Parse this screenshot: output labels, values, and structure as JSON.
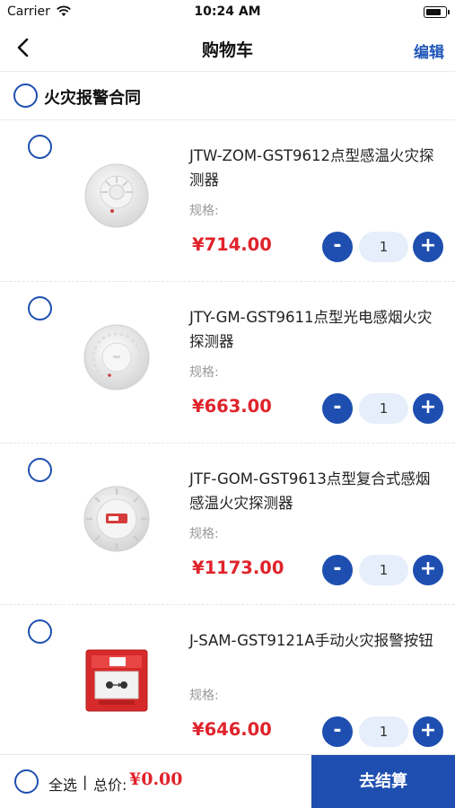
{
  "status_bar": {
    "carrier": "Carrier",
    "time": "10:24 AM"
  },
  "nav": {
    "title": "购物车",
    "edit_label": "编辑"
  },
  "group": {
    "title": "火灾报警合同"
  },
  "items": [
    {
      "name": "JTW-ZOM-GST9612点型感温火灾探测器",
      "spec_label": "规格:",
      "price": "¥714.00",
      "qty": "1",
      "minus": "-",
      "plus": "+",
      "image": "heat-detector"
    },
    {
      "name": "JTY-GM-GST9611点型光电感烟火灾探测器",
      "spec_label": "规格:",
      "price": "¥663.00",
      "qty": "1",
      "minus": "-",
      "plus": "+",
      "image": "smoke-detector"
    },
    {
      "name": "JTF-GOM-GST9613点型复合式感烟感温火灾探测器",
      "spec_label": "规格:",
      "price": "¥1173.00",
      "qty": "1",
      "minus": "-",
      "plus": "+",
      "image": "combo-detector"
    },
    {
      "name": "J-SAM-GST9121A手动火灾报警按钮",
      "spec_label": "规格:",
      "price": "¥646.00",
      "qty": "1",
      "minus": "-",
      "plus": "+",
      "image": "manual-alarm-button"
    }
  ],
  "bottom": {
    "select_all": "全选",
    "separator": "|",
    "total_label": "总价:",
    "total_value": "¥0.00",
    "checkout_label": "去结算"
  },
  "colors": {
    "accent": "#1e4fb0",
    "price": "#e0232b",
    "qty_bg": "#e6eefb"
  }
}
